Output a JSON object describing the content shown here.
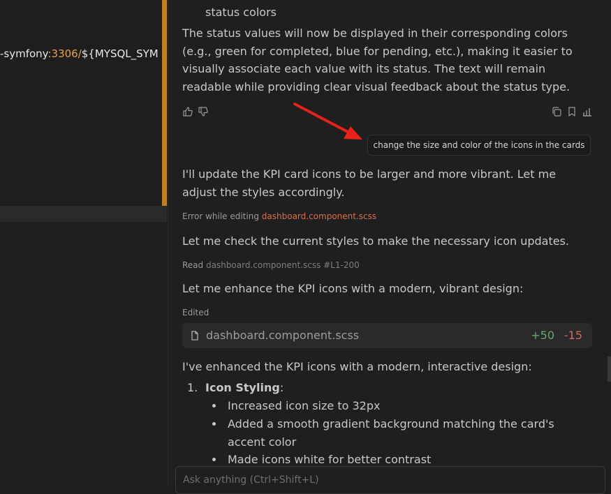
{
  "editor": {
    "code_prefix": "-symfony",
    "code_port": ":3306/",
    "code_suffix": "${MYSQL_SYM"
  },
  "chat": {
    "prev_list_tail": "status colors",
    "status_paragraph": "The status values will now be displayed in their corresponding colors (e.g., green for completed, blue for pending, etc.), making it easier to visually associate each value with its status. The text will remain readable while providing clear visual feedback about the status type.",
    "user_message": "change the size and color of the icons in the cards",
    "reply_1": "I'll update the KPI card icons to be larger and more vibrant. Let me adjust the styles accordingly.",
    "error_label": "Error while editing",
    "error_file": "dashboard.component.scss",
    "reply_2": "Let me check the current styles to make the necessary icon updates.",
    "read_label": "Read",
    "read_file": "dashboard.component.scss #L1-200",
    "reply_3": "Let me enhance the KPI icons with a modern, vibrant design:",
    "edited_label": "Edited",
    "edited_file": {
      "name": "dashboard.component.scss",
      "additions": "+50",
      "deletions": "-15"
    },
    "reply_4": "I've enhanced the KPI icons with a modern, interactive design:",
    "list": {
      "item_number": "1.",
      "item_title": "Icon Styling",
      "item_colon": ":",
      "bullets": [
        "Increased icon size to 32px",
        "Added a smooth gradient background matching the card's accent color",
        "Made icons white for better contrast"
      ]
    }
  },
  "input": {
    "placeholder": "Ask anything (Ctrl+Shift+L)"
  },
  "colors": {
    "accent_orange": "#c47f1d",
    "link": "#e06c4b",
    "diff_add": "#6aa56f",
    "diff_del": "#d26a5e",
    "annotation_arrow": "#e8211b"
  },
  "icons": {
    "feedback": [
      "thumbs-up-icon",
      "thumbs-down-icon"
    ],
    "actions": [
      "copy-icon",
      "bookmark-icon",
      "chart-icon"
    ],
    "file": "file-icon"
  }
}
